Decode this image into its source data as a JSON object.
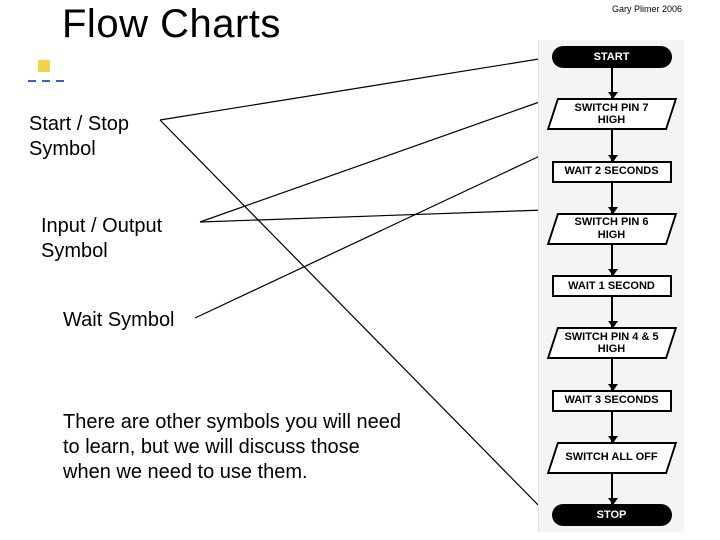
{
  "title": "Flow Charts",
  "author": "Gary Plimer 2006",
  "labels": {
    "start_line1": "Start / Stop",
    "start_line2": "Symbol",
    "io_line1": "Input / Output",
    "io_line2": "Symbol",
    "wait": "Wait Symbol"
  },
  "paragraph": "There are other symbols you will need to learn, but we will discuss those when we need to use them.",
  "flow": {
    "start": "START",
    "n1": "SWITCH PIN 7 HIGH",
    "n2": "WAIT 2 SECONDS",
    "n3": "SWITCH PIN 6 HIGH",
    "n4": "WAIT 1 SECOND",
    "n5": "SWITCH PIN 4 & 5 HIGH",
    "n6": "WAIT 3 SECONDS",
    "n7": "SWITCH ALL OFF",
    "stop": "STOP"
  }
}
